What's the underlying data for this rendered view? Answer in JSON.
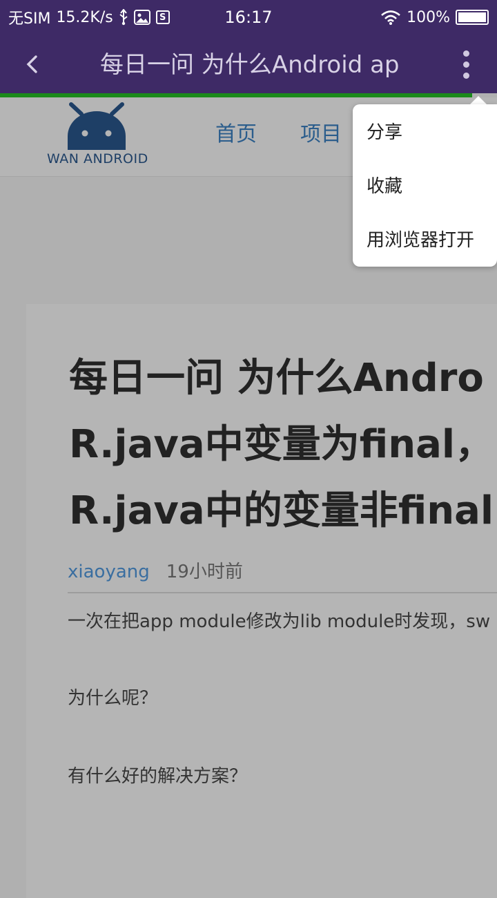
{
  "status_bar": {
    "carrier": "无SIM",
    "speed": "15.2K/s",
    "usb_icon": "usb-icon",
    "notification_icon": "photo-icon",
    "s_badge": "S",
    "time": "16:17",
    "battery": "100%",
    "battery_level": 1.0
  },
  "app_bar": {
    "title": "每日一问 为什么Android ap",
    "back_icon": "chevron-left-icon",
    "more_icon": "more-vertical-icon",
    "progress": 0.95
  },
  "site": {
    "logo_text": "WAN ANDROID",
    "nav": [
      "首页",
      "项目"
    ]
  },
  "article": {
    "title_lines": [
      "每日一问 为什么Andro",
      "R.java中变量为final，",
      "R.java中的变量非final"
    ],
    "author": "xiaoyang",
    "time": "19小时前",
    "paragraphs": [
      "一次在把app module修改为lib module时发现，sw",
      "为什么呢？",
      "有什么好的解决方案？"
    ]
  },
  "menu": {
    "items": [
      "分享",
      "收藏",
      "用浏览器打开"
    ]
  },
  "colors": {
    "toolbar": "#3e2a66",
    "progress": "#1b8a1b",
    "link": "#3a6ea0"
  }
}
